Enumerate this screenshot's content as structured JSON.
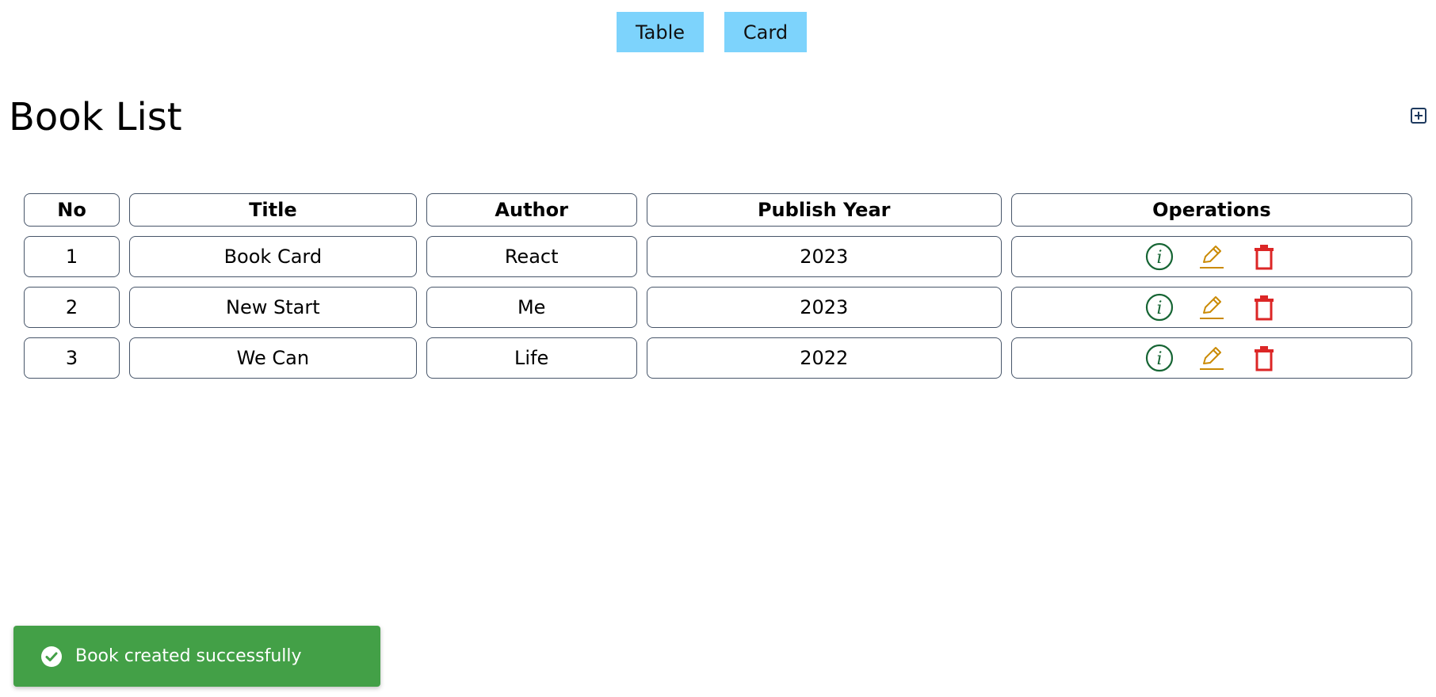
{
  "view_toggle": {
    "table_label": "Table",
    "card_label": "Card"
  },
  "header": {
    "title": "Book List",
    "add_icon": "plus-square-icon"
  },
  "table": {
    "headers": {
      "no": "No",
      "title": "Title",
      "author": "Author",
      "year": "Publish Year",
      "operations": "Operations"
    },
    "rows": [
      {
        "no": "1",
        "title": "Book Card",
        "author": "React",
        "year": "2023"
      },
      {
        "no": "2",
        "title": "New Start",
        "author": "Me",
        "year": "2023"
      },
      {
        "no": "3",
        "title": "We Can",
        "author": "Life",
        "year": "2022"
      }
    ],
    "operation_icons": [
      "info-circle-icon",
      "edit-pencil-icon",
      "trash-icon"
    ]
  },
  "toast": {
    "message": "Book created successfully",
    "icon": "check-circle-icon"
  },
  "colors": {
    "toggle_bg": "#7dd3fc",
    "info": "#166534",
    "edit": "#ca8a04",
    "delete": "#dc2626",
    "add": "#1e3a5f",
    "toast_bg": "#43a047"
  }
}
